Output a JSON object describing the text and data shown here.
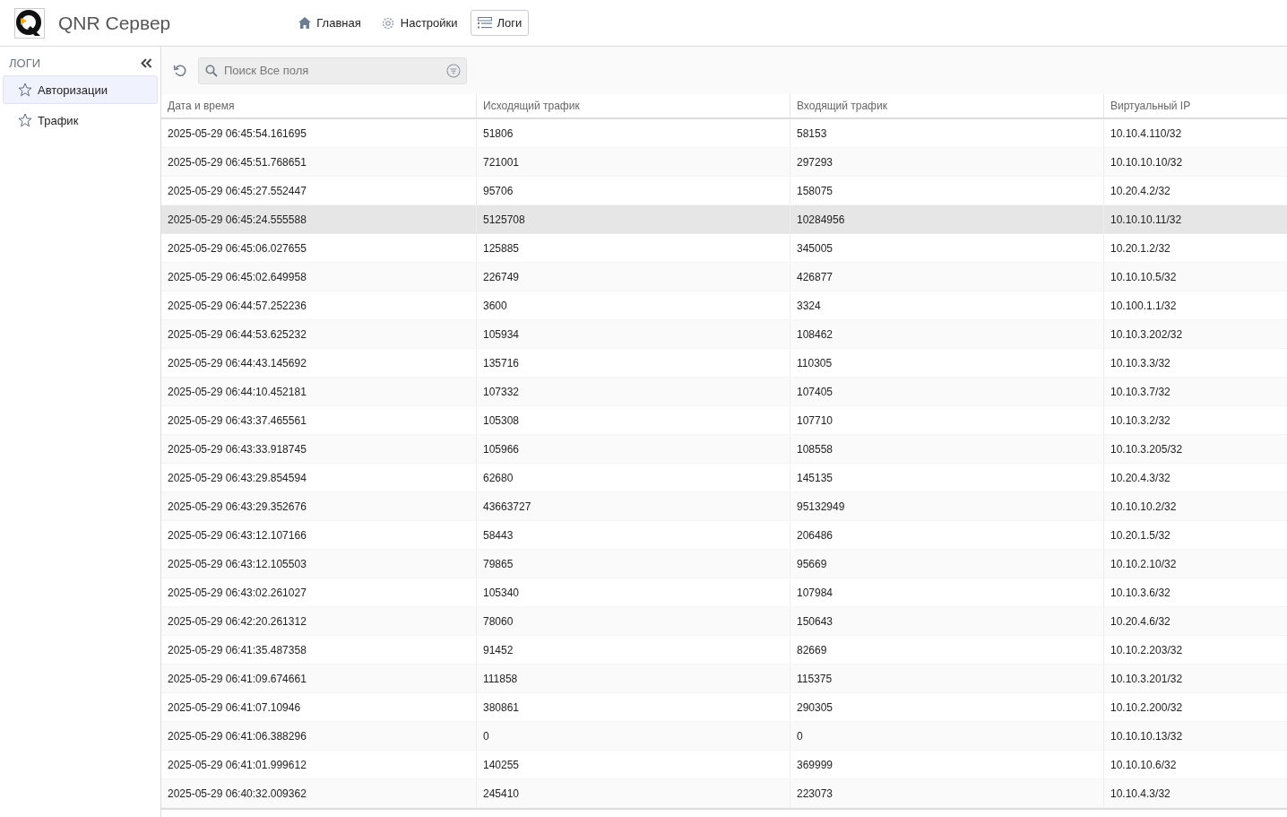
{
  "app": {
    "title": "QNR Сервер"
  },
  "nav": [
    {
      "label": "Главная",
      "selected": false
    },
    {
      "label": "Настройки",
      "selected": false
    },
    {
      "label": "Логи",
      "selected": true
    }
  ],
  "sidebar": {
    "title": "ЛОГИ",
    "items": [
      {
        "label": "Авторизации",
        "selected": true
      },
      {
        "label": "Трафик",
        "selected": false
      }
    ]
  },
  "search": {
    "placeholder": "Поиск Все поля"
  },
  "table": {
    "columns": [
      "Дата и время",
      "Исходящий трафик",
      "Входящий трафик",
      "Виртуальный IP"
    ],
    "rows": [
      {
        "cells": [
          "2025-05-29 06:45:54.161695",
          "51806",
          "58153",
          "10.10.4.110/32"
        ],
        "selected": false
      },
      {
        "cells": [
          "2025-05-29 06:45:51.768651",
          "721001",
          "297293",
          "10.10.10.10/32"
        ],
        "selected": false
      },
      {
        "cells": [
          "2025-05-29 06:45:27.552447",
          "95706",
          "158075",
          "10.20.4.2/32"
        ],
        "selected": false
      },
      {
        "cells": [
          "2025-05-29 06:45:24.555588",
          "5125708",
          "10284956",
          "10.10.10.11/32"
        ],
        "selected": true
      },
      {
        "cells": [
          "2025-05-29 06:45:06.027655",
          "125885",
          "345005",
          "10.20.1.2/32"
        ],
        "selected": false
      },
      {
        "cells": [
          "2025-05-29 06:45:02.649958",
          "226749",
          "426877",
          "10.10.10.5/32"
        ],
        "selected": false
      },
      {
        "cells": [
          "2025-05-29 06:44:57.252236",
          "3600",
          "3324",
          "10.100.1.1/32"
        ],
        "selected": false
      },
      {
        "cells": [
          "2025-05-29 06:44:53.625232",
          "105934",
          "108462",
          "10.10.3.202/32"
        ],
        "selected": false
      },
      {
        "cells": [
          "2025-05-29 06:44:43.145692",
          "135716",
          "110305",
          "10.10.3.3/32"
        ],
        "selected": false
      },
      {
        "cells": [
          "2025-05-29 06:44:10.452181",
          "107332",
          "107405",
          "10.10.3.7/32"
        ],
        "selected": false
      },
      {
        "cells": [
          "2025-05-29 06:43:37.465561",
          "105308",
          "107710",
          "10.10.3.2/32"
        ],
        "selected": false
      },
      {
        "cells": [
          "2025-05-29 06:43:33.918745",
          "105966",
          "108558",
          "10.10.3.205/32"
        ],
        "selected": false
      },
      {
        "cells": [
          "2025-05-29 06:43:29.854594",
          "62680",
          "145135",
          "10.20.4.3/32"
        ],
        "selected": false
      },
      {
        "cells": [
          "2025-05-29 06:43:29.352676",
          "43663727",
          "95132949",
          "10.10.10.2/32"
        ],
        "selected": false
      },
      {
        "cells": [
          "2025-05-29 06:43:12.107166",
          "58443",
          "206486",
          "10.20.1.5/32"
        ],
        "selected": false
      },
      {
        "cells": [
          "2025-05-29 06:43:12.105503",
          "79865",
          "95669",
          "10.10.2.10/32"
        ],
        "selected": false
      },
      {
        "cells": [
          "2025-05-29 06:43:02.261027",
          "105340",
          "107984",
          "10.10.3.6/32"
        ],
        "selected": false
      },
      {
        "cells": [
          "2025-05-29 06:42:20.261312",
          "78060",
          "150643",
          "10.20.4.6/32"
        ],
        "selected": false
      },
      {
        "cells": [
          "2025-05-29 06:41:35.487358",
          "91452",
          "82669",
          "10.10.2.203/32"
        ],
        "selected": false
      },
      {
        "cells": [
          "2025-05-29 06:41:09.674661",
          "111858",
          "115375",
          "10.10.3.201/32"
        ],
        "selected": false
      },
      {
        "cells": [
          "2025-05-29 06:41:07.10946",
          "380861",
          "290305",
          "10.10.2.200/32"
        ],
        "selected": false
      },
      {
        "cells": [
          "2025-05-29 06:41:06.388296",
          "0",
          "0",
          "10.10.10.13/32"
        ],
        "selected": false
      },
      {
        "cells": [
          "2025-05-29 06:41:01.999612",
          "140255",
          "369999",
          "10.10.10.6/32"
        ],
        "selected": false
      },
      {
        "cells": [
          "2025-05-29 06:40:32.009362",
          "245410",
          "223073",
          "10.10.4.3/32"
        ],
        "selected": false
      }
    ]
  }
}
